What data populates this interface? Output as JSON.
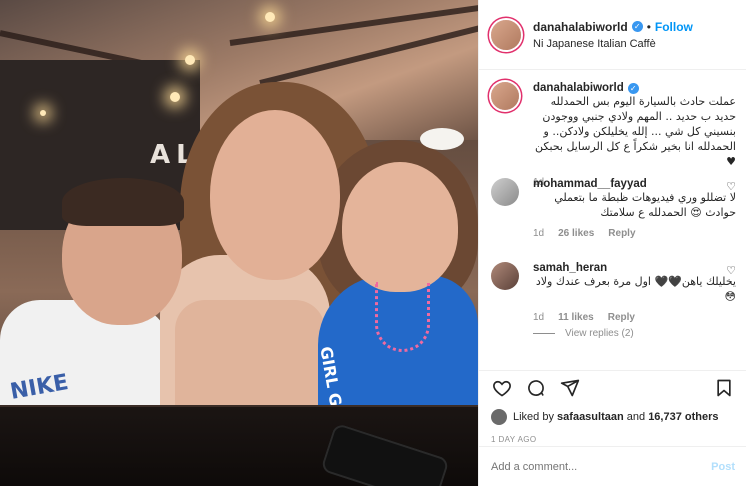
{
  "post": {
    "username": "danahalabiworld",
    "location": "Ni Japanese Italian Caffè",
    "follow_label": "Follow",
    "separator": "•",
    "verified_glyph": "✓",
    "photo": {
      "sign_text": "ALAD",
      "boy_shirt_text": "NIKE",
      "girl_shirt_text": "GIRL GANG"
    }
  },
  "caption": {
    "username": "danahalabiworld",
    "text": "عملت حادث بالسيارة اليوم بس الحمدلله حديد ب حديد .. المهم ولادي جنبي ووجودن بنسيني كل شي ... إلله يخليلكن ولادكن.. و الحمدلله انا بخير شكراً ع كل الرسايل بحبكن ♥",
    "time": "1d"
  },
  "comments": [
    {
      "username": "mohammad__fayyad",
      "text": "لا تضللو وري فيديوهات ظبطة ما بتعملي حوادث 😍 الحمدلله ع سلامتك",
      "time": "1d",
      "likes": "26 likes",
      "reply": "Reply",
      "heart": "♡"
    },
    {
      "username": "samah_heran",
      "text": "يخليلك ياهن🖤🖤 اول مرة بعرف عندك ولاد 😳",
      "time": "1d",
      "likes": "11 likes",
      "reply": "Reply",
      "heart": "♡"
    }
  ],
  "view_replies": "View replies (2)",
  "likes": {
    "prefix": "Liked by ",
    "user": "safaasultaan",
    "middle": " and ",
    "others": "16,737 others"
  },
  "timestamp": "1 DAY AGO",
  "add_comment": {
    "placeholder": "Add a comment...",
    "post_label": "Post"
  },
  "colors": {
    "accent": "#0095f6",
    "post_disabled": "#b2dffc",
    "story_ring": "#e1306c",
    "verified": "#3897f0"
  },
  "icons": [
    "heart-icon",
    "comment-icon",
    "share-icon",
    "bookmark-icon"
  ]
}
